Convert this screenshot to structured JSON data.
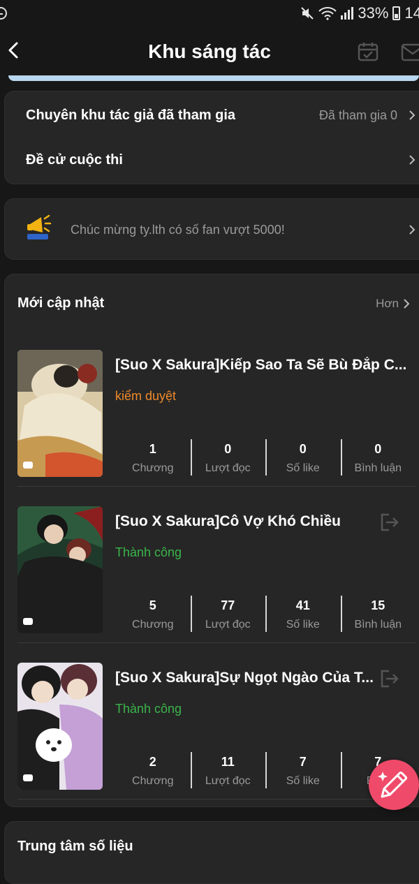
{
  "status_bar": {
    "battery": "33%",
    "time": "14:"
  },
  "header": {
    "title": "Khu sáng tác"
  },
  "menu": {
    "joined_zone_label": "Chuyên khu tác giả đã tham gia",
    "joined_zone_value": "Đã tham gia 0",
    "contest_label": "Đề cử cuộc thi"
  },
  "notice": {
    "text": "Chúc mừng ty.lth có số fan vượt 5000!"
  },
  "recent": {
    "title": "Mới cập nhật",
    "more": "Hơn",
    "books": [
      {
        "title": "[Suo X Sakura]Kiếp Sao Ta Sẽ Bù Đắp C...",
        "status": "kiểm duyệt",
        "stats": [
          {
            "num": "1",
            "label": "Chương"
          },
          {
            "num": "0",
            "label": "Lượt đọc"
          },
          {
            "num": "0",
            "label": "Số like"
          },
          {
            "num": "0",
            "label": "Bình luận"
          }
        ]
      },
      {
        "title": "[Suo X Sakura]Cô Vợ Khó Chiều",
        "status": "Thành công",
        "stats": [
          {
            "num": "5",
            "label": "Chương"
          },
          {
            "num": "77",
            "label": "Lượt đọc"
          },
          {
            "num": "41",
            "label": "Số like"
          },
          {
            "num": "15",
            "label": "Bình luận"
          }
        ]
      },
      {
        "title": "[Suo X Sakura]Sự Ngọt Ngào Của T...",
        "status": "Thành công",
        "stats": [
          {
            "num": "2",
            "label": "Chương"
          },
          {
            "num": "11",
            "label": "Lượt đọc"
          },
          {
            "num": "7",
            "label": "Số like"
          },
          {
            "num": "7",
            "label": "Bình"
          }
        ]
      }
    ]
  },
  "data_center": {
    "title": "Trung tâm số liệu"
  },
  "colors": {
    "review": "#f08a2a",
    "success": "#3ab54a",
    "fab": "#f04a6a",
    "accent_strip": "#b9d7ee"
  }
}
